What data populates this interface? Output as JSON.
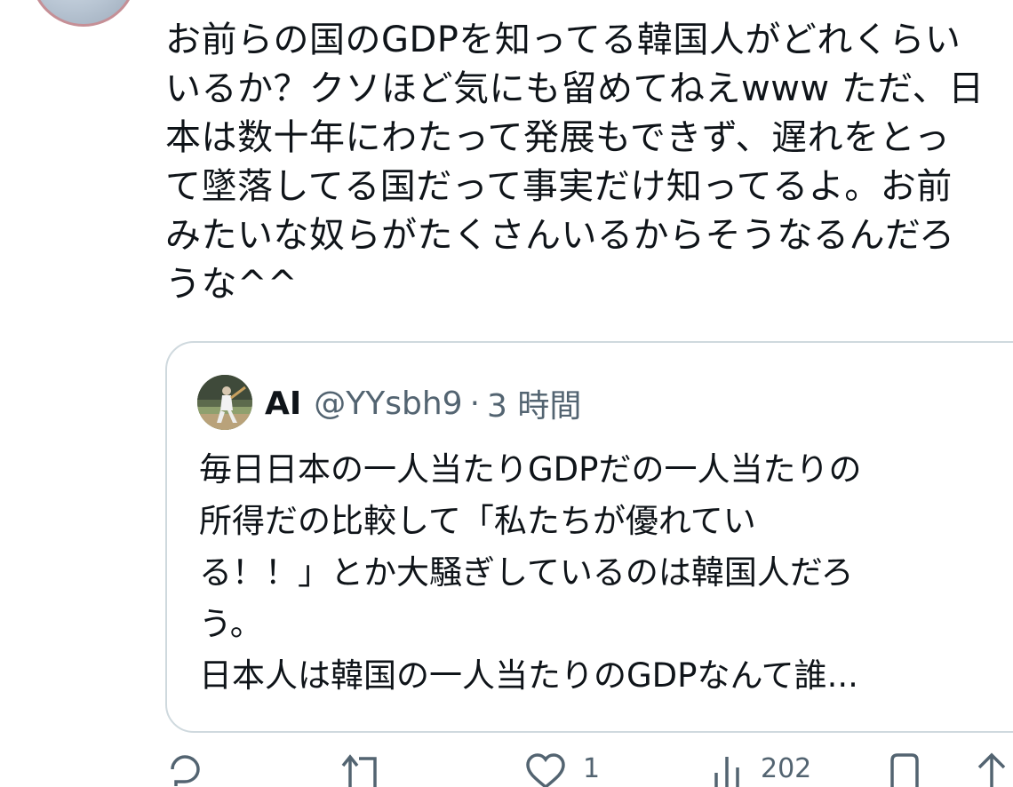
{
  "tweet": {
    "text": "お前らの国のGDPを知ってる韓国人がどれくらい\nいるか？クソほど気にも留めてねえwww ただ、日\n本は数十年にわたって発展もできず、遅れをとっ\nて墜落してる国だって事実だけ知ってるよ。お前\nみたいな奴らがたくさんいるからそうなるんだろ\nうな^^"
  },
  "quote": {
    "name": "AI",
    "handle": "@YYsbh9",
    "separator": "·",
    "time": "3 時間",
    "text": "毎日日本の一人当たりGDPだの一人当たりの\n所得だの比較して「私たちが優れてい\nる！！」とか大騒ぎしているのは韓国人だろ\nう。\n日本人は韓国の一人当たりのGDPなんて誰..."
  },
  "actions": {
    "reply_icon": "reply-icon",
    "retweet_icon": "retweet-icon",
    "like_icon": "heart-icon",
    "like_count": "1",
    "views_icon": "views-icon",
    "views_count": "202",
    "share_icon": "share-icon"
  },
  "colors": {
    "text": "#0f1419",
    "secondary": "#536471",
    "border": "#cfd9de"
  }
}
